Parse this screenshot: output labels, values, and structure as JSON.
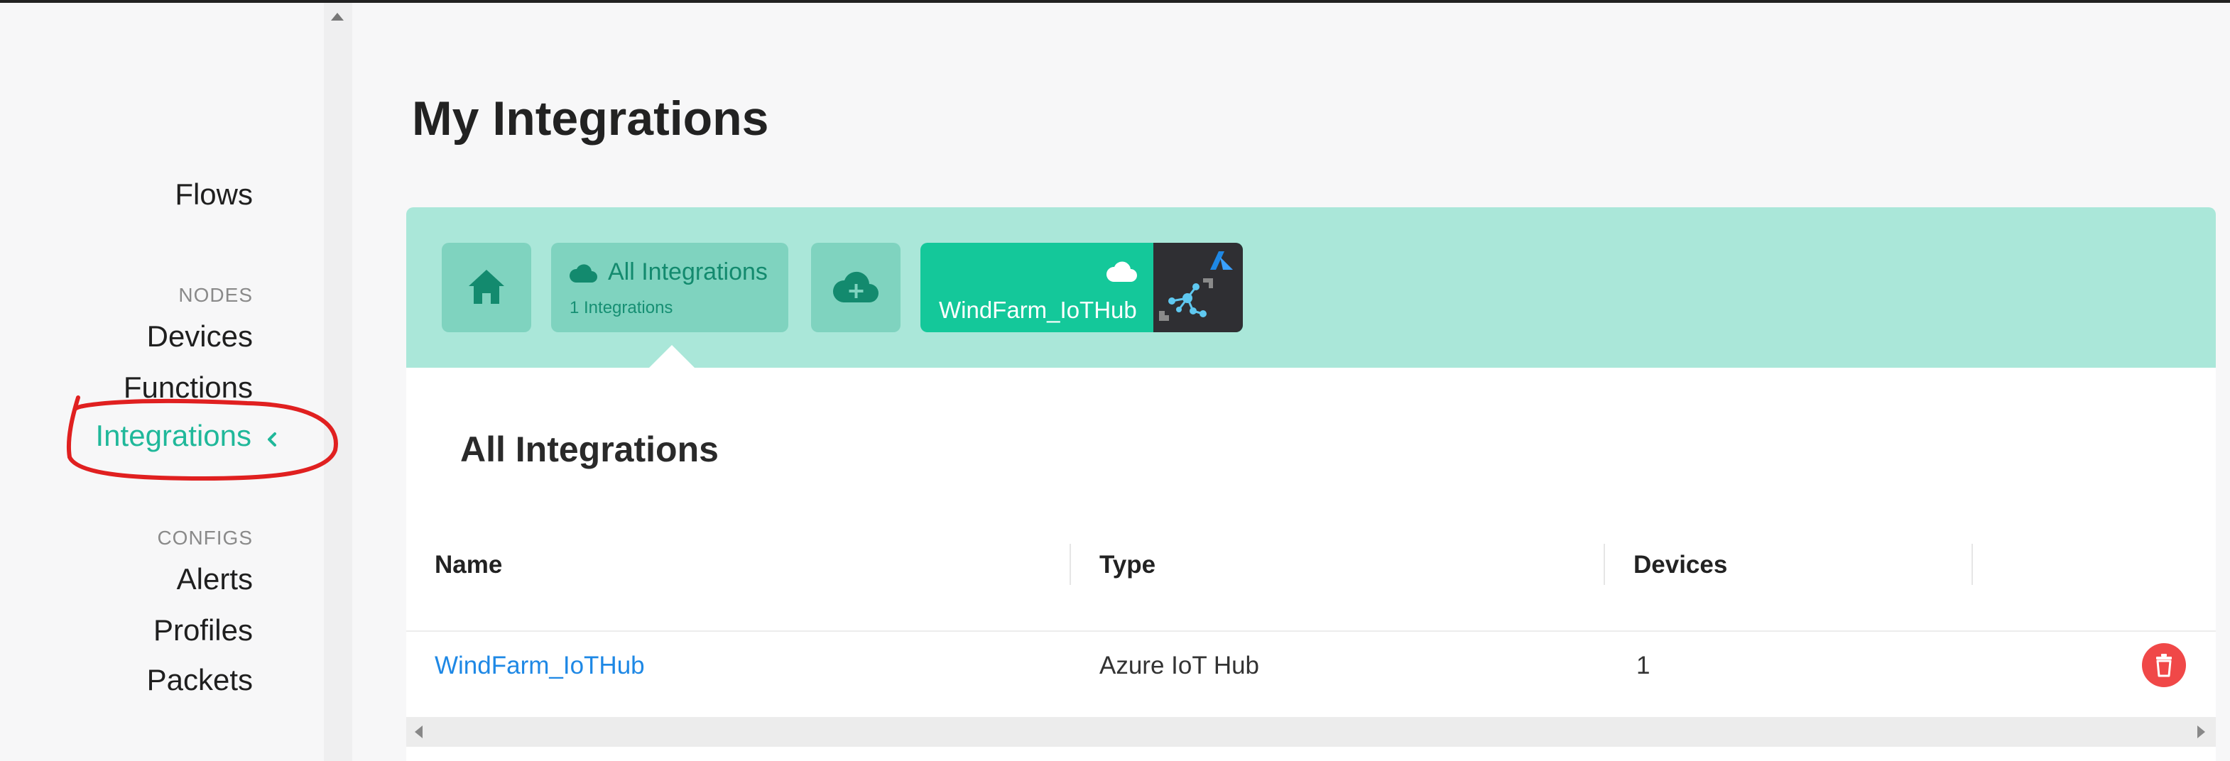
{
  "page": {
    "title": "My Integrations"
  },
  "sidebar": {
    "top_item": "Flows",
    "nodes_header": "NODES",
    "nodes": [
      "Devices",
      "Functions",
      "Integrations"
    ],
    "active_item": "Integrations",
    "configs_header": "CONFIGS",
    "configs": [
      "Alerts",
      "Profiles",
      "Packets"
    ]
  },
  "tabs": {
    "home_icon": "home-icon",
    "all": {
      "title": "All Integrations",
      "subtitle": "1 Integrations",
      "icon": "cloud-icon"
    },
    "add_icon": "cloud-plus-icon",
    "integration": {
      "label": "WindFarm_IoTHub",
      "icon": "cloud-icon",
      "logo": "azure-iot-hub-logo"
    }
  },
  "section": {
    "title": "All Integrations"
  },
  "table": {
    "headers": [
      "Name",
      "Type",
      "Devices"
    ],
    "rows": [
      {
        "name": "WindFarm_IoTHub",
        "type": "Azure IoT Hub",
        "devices": "1"
      }
    ]
  },
  "colors": {
    "accent": "#20b89a",
    "tabbar_bg": "#aae7d9",
    "tab_button": "#7fd3bf",
    "integration_tab": "#14c89a",
    "link": "#1e88e5",
    "delete": "#f04848",
    "annotation": "#e02020"
  }
}
